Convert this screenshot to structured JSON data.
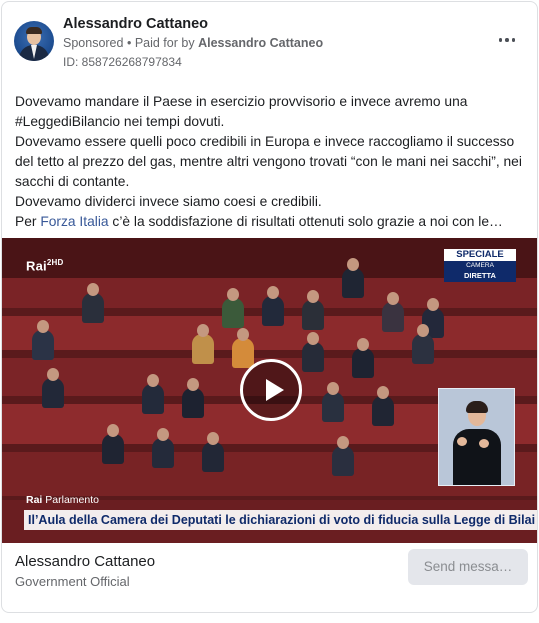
{
  "advertiser": {
    "name": "Alessandro Cattaneo",
    "sponsored": "Sponsored",
    "paid_prefix": "Paid for by",
    "paid_by": "Alessandro Cattaneo",
    "ad_id": "ID: 858726268797834"
  },
  "post": {
    "line1": "Dovevamo mandare il Paese in esercizio provvisorio e invece avremo una",
    "line2": "#LeggediBilancio nei tempi dovuti.",
    "line3": "Dovevamo essere quelli poco credibili in Europa e invece raccogliamo il successo",
    "line4": "del tetto al prezzo del gas, mentre altri vengono trovati “con le mani nei sacchi”, nei",
    "line5": "sacchi di contante.",
    "line6": "Dovevamo dividerci invece siamo coesi e credibili.",
    "line7_prefix": "Per",
    "line7_link": "Forza Italia",
    "line7_rest": "c’è la soddisfazione di risultati ottenuti solo grazie a noi con le…"
  },
  "video": {
    "channel_logo": "Rai",
    "channel_num": "2HD",
    "badge_top": "SPECIALE",
    "badge_mid": "CAMERA",
    "badge_bottom": "DIRETTA",
    "ticker_brand": "Rai",
    "ticker_label": "Parlamento",
    "ticker_text": "Il’Aula della Camera dei Deputati le dichiarazioni di voto di fiducia sulla Legge di Bilai"
  },
  "footer": {
    "name": "Alessandro Cattaneo",
    "role": "Government Official",
    "send_label": "Send messa…"
  },
  "colors": {
    "link": "#385898",
    "secondary_text": "#65676b",
    "button_bg": "#e4e6eb"
  }
}
